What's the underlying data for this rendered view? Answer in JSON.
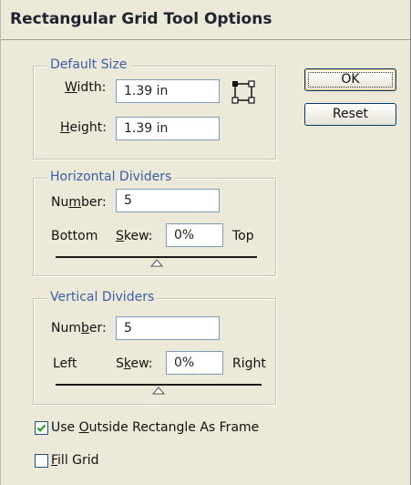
{
  "dialog": {
    "title": "Rectangular Grid Tool Options"
  },
  "default_size": {
    "legend": "Default Size",
    "width_label_mnemonic": "W",
    "width_label_rest": "idth:",
    "width_value": "1.39 in",
    "height_label_mnemonic": "H",
    "height_label_rest": "eight:",
    "height_value": "1.39 in",
    "icon": "reference-point-icon"
  },
  "horizontal_dividers": {
    "legend": "Horizontal Dividers",
    "number_label_pre": "Nu",
    "number_label_mnemonic": "m",
    "number_label_post": "ber:",
    "number_value": "5",
    "left_end": "Bottom",
    "skew_label_mnemonic": "S",
    "skew_label_rest": "kew:",
    "skew_value": "0%",
    "right_end": "Top",
    "skew_level": 0.5
  },
  "vertical_dividers": {
    "legend": "Vertical Dividers",
    "number_label_pre": "Num",
    "number_label_mnemonic": "b",
    "number_label_post": "er:",
    "number_value": "5",
    "left_end": "Left",
    "skew_label_pre": "S",
    "skew_label_mnemonic": "k",
    "skew_label_post": "ew:",
    "skew_value": "0%",
    "right_end": "Right",
    "skew_level": 0.5
  },
  "options": {
    "use_outside_pre": "Use ",
    "use_outside_mnemonic": "O",
    "use_outside_post": "utside Rectangle As Frame",
    "use_outside_checked": true,
    "fill_grid_mnemonic": "F",
    "fill_grid_post": "ill Grid",
    "fill_grid_checked": false
  },
  "buttons": {
    "ok": "OK",
    "reset": "Reset"
  }
}
